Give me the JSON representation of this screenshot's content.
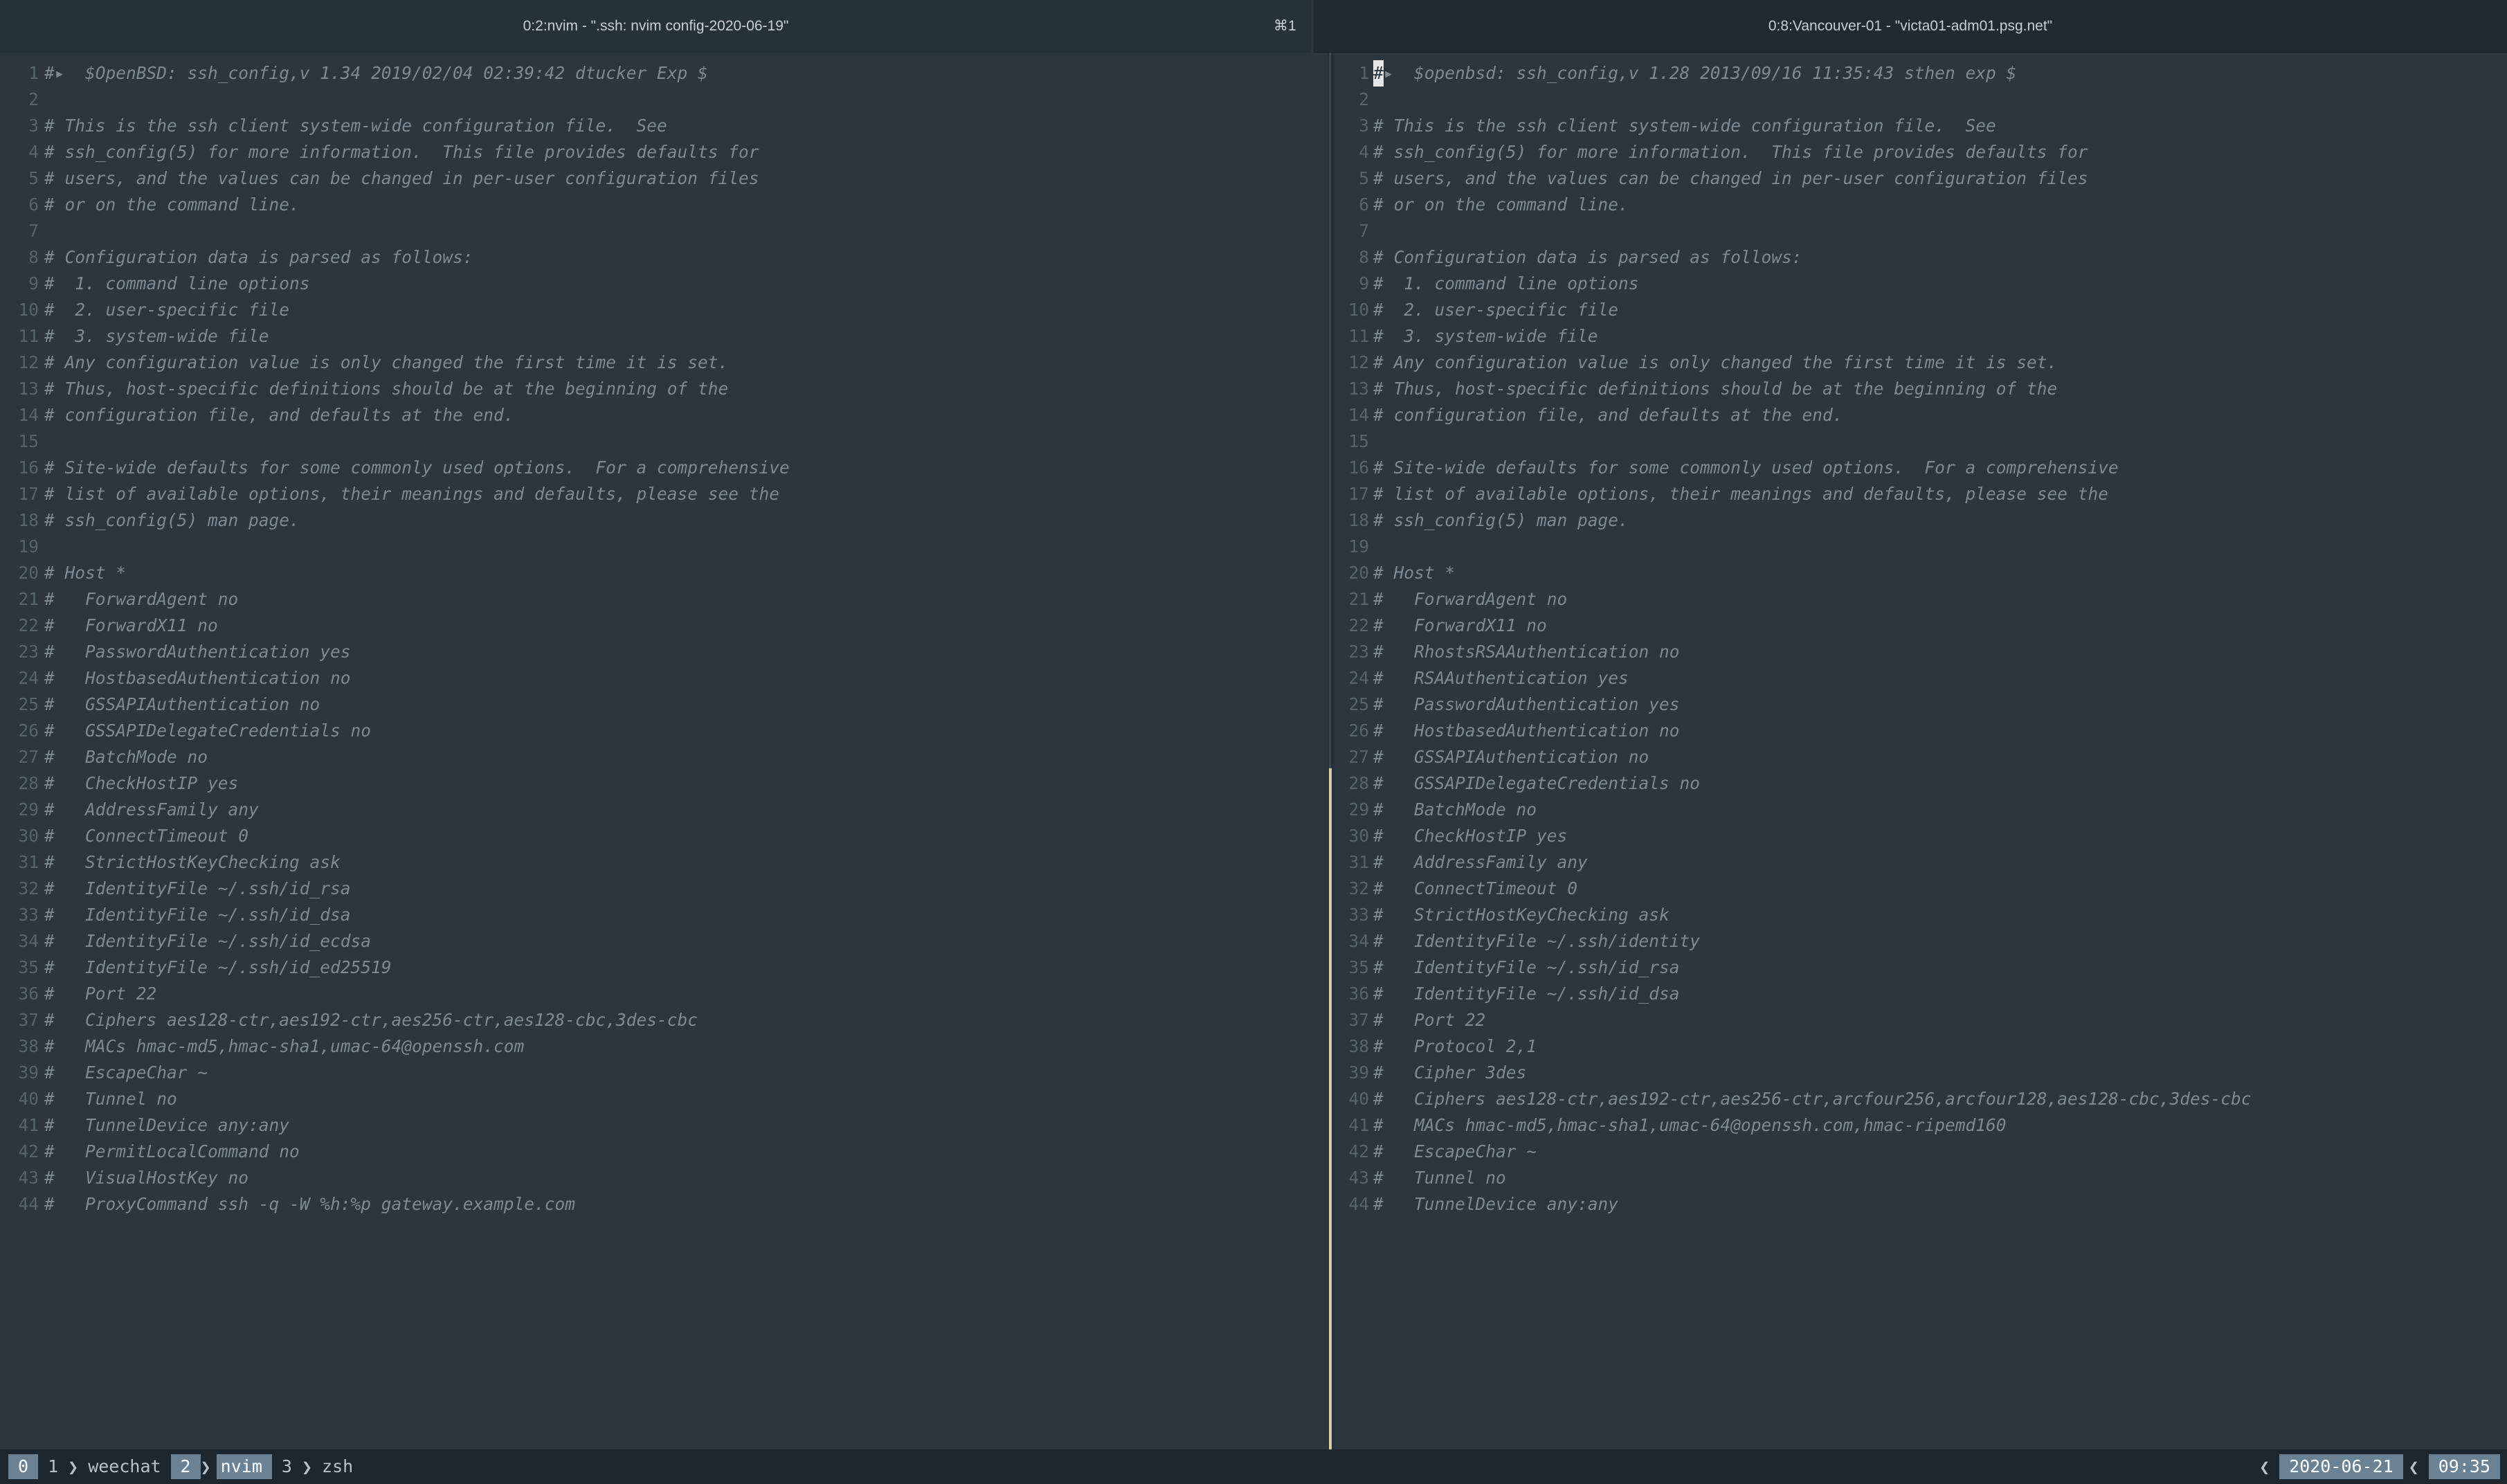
{
  "titles": {
    "left": "0:2:nvim - \".ssh: nvim config-2020-06-19\"",
    "shortcut": "⌘1",
    "right": "0:8:Vancouver-01 - \"victa01-adm01.psg.net\""
  },
  "left_pane": {
    "lines": [
      "#▸  $OpenBSD: ssh_config,v 1.34 2019/02/04 02:39:42 dtucker Exp $",
      "",
      "# This is the ssh client system-wide configuration file.  See",
      "# ssh_config(5) for more information.  This file provides defaults for",
      "# users, and the values can be changed in per-user configuration files",
      "# or on the command line.",
      "",
      "# Configuration data is parsed as follows:",
      "#  1. command line options",
      "#  2. user-specific file",
      "#  3. system-wide file",
      "# Any configuration value is only changed the first time it is set.",
      "# Thus, host-specific definitions should be at the beginning of the",
      "# configuration file, and defaults at the end.",
      "",
      "# Site-wide defaults for some commonly used options.  For a comprehensive",
      "# list of available options, their meanings and defaults, please see the",
      "# ssh_config(5) man page.",
      "",
      "# Host *",
      "#   ForwardAgent no",
      "#   ForwardX11 no",
      "#   PasswordAuthentication yes",
      "#   HostbasedAuthentication no",
      "#   GSSAPIAuthentication no",
      "#   GSSAPIDelegateCredentials no",
      "#   BatchMode no",
      "#   CheckHostIP yes",
      "#   AddressFamily any",
      "#   ConnectTimeout 0",
      "#   StrictHostKeyChecking ask",
      "#   IdentityFile ~/.ssh/id_rsa",
      "#   IdentityFile ~/.ssh/id_dsa",
      "#   IdentityFile ~/.ssh/id_ecdsa",
      "#   IdentityFile ~/.ssh/id_ed25519",
      "#   Port 22",
      "#   Ciphers aes128-ctr,aes192-ctr,aes256-ctr,aes128-cbc,3des-cbc",
      "#   MACs hmac-md5,hmac-sha1,umac-64@openssh.com",
      "#   EscapeChar ~",
      "#   Tunnel no",
      "#   TunnelDevice any:any",
      "#   PermitLocalCommand no",
      "#   VisualHostKey no",
      "#   ProxyCommand ssh -q -W %h:%p gateway.example.com"
    ]
  },
  "right_pane": {
    "cursor_char": "#",
    "first_line_rest": "▸  $openbsd: ssh_config,v 1.28 2013/09/16 11:35:43 sthen exp $",
    "lines": [
      "",
      "",
      "# This is the ssh client system-wide configuration file.  See",
      "# ssh_config(5) for more information.  This file provides defaults for",
      "# users, and the values can be changed in per-user configuration files",
      "# or on the command line.",
      "",
      "# Configuration data is parsed as follows:",
      "#  1. command line options",
      "#  2. user-specific file",
      "#  3. system-wide file",
      "# Any configuration value is only changed the first time it is set.",
      "# Thus, host-specific definitions should be at the beginning of the",
      "# configuration file, and defaults at the end.",
      "",
      "# Site-wide defaults for some commonly used options.  For a comprehensive",
      "# list of available options, their meanings and defaults, please see the",
      "# ssh_config(5) man page.",
      "",
      "# Host *",
      "#   ForwardAgent no",
      "#   ForwardX11 no",
      "#   RhostsRSAAuthentication no",
      "#   RSAAuthentication yes",
      "#   PasswordAuthentication yes",
      "#   HostbasedAuthentication no",
      "#   GSSAPIAuthentication no",
      "#   GSSAPIDelegateCredentials no",
      "#   BatchMode no",
      "#   CheckHostIP yes",
      "#   AddressFamily any",
      "#   ConnectTimeout 0",
      "#   StrictHostKeyChecking ask",
      "#   IdentityFile ~/.ssh/identity",
      "#   IdentityFile ~/.ssh/id_rsa",
      "#   IdentityFile ~/.ssh/id_dsa",
      "#   Port 22",
      "#   Protocol 2,1",
      "#   Cipher 3des",
      "#   Ciphers aes128-ctr,aes192-ctr,aes256-ctr,arcfour256,arcfour128,aes128-cbc,3des-cbc",
      "#   MACs hmac-md5,hmac-sha1,umac-64@openssh.com,hmac-ripemd160",
      "#   EscapeChar ~",
      "#   Tunnel no",
      "#   TunnelDevice any:any"
    ]
  },
  "statusbar": {
    "session": "0",
    "windows": [
      {
        "index": "1",
        "name": "weechat",
        "current": false
      },
      {
        "index": "2",
        "name": "nvim",
        "current": true
      },
      {
        "index": "3",
        "name": "zsh",
        "current": false
      }
    ],
    "date": "2020-06-21",
    "time": "09:35"
  },
  "colors": {
    "background": "#2b363e",
    "comment": "#7d8a94",
    "line_number": "#56646e",
    "status_highlight": "#6b8295",
    "active_divider": "#d7cf9b"
  }
}
